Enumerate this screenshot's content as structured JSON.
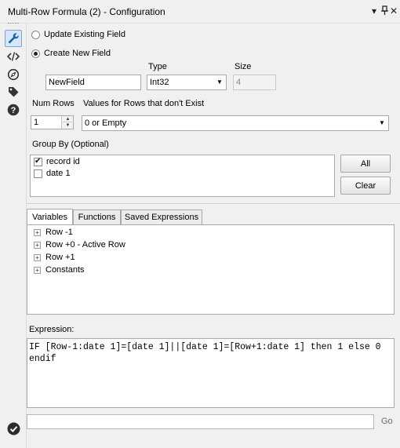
{
  "window": {
    "title": "Multi-Row Formula (2) - Configuration",
    "controls": {
      "dropdown": "▾",
      "pin": "ᵒ",
      "close": "✕"
    }
  },
  "toolbar": {
    "items": [
      {
        "name": "configuration",
        "icon": "wrench-icon"
      },
      {
        "name": "xml",
        "icon": "code-icon"
      },
      {
        "name": "annotation",
        "icon": "compass-icon"
      },
      {
        "name": "tag",
        "icon": "tag-icon"
      },
      {
        "name": "help",
        "icon": "help-icon"
      }
    ]
  },
  "options": {
    "update_existing_label": "Update Existing Field",
    "create_new_label": "Create New  Field",
    "selected": "create_new"
  },
  "new_field": {
    "name_value": "NewField",
    "type_label": "Type",
    "type_value": "Int32",
    "size_label": "Size",
    "size_value": "4"
  },
  "num_rows": {
    "label": "Num Rows",
    "value": "1"
  },
  "nonexistent_rows": {
    "label": "Values for Rows that don't Exist",
    "value": "0 or Empty"
  },
  "group_by": {
    "label": "Group By (Optional)",
    "items": [
      {
        "label": "record id",
        "checked": true
      },
      {
        "label": "date 1",
        "checked": false
      }
    ],
    "all_button": "All",
    "clear_button": "Clear"
  },
  "tabs": [
    {
      "label": "Variables",
      "active": true
    },
    {
      "label": "Functions",
      "active": false
    },
    {
      "label": "Saved Expressions",
      "active": false
    }
  ],
  "variables_tree": [
    {
      "label": "Row -1"
    },
    {
      "label": "Row +0 - Active Row"
    },
    {
      "label": "Row +1"
    },
    {
      "label": "Constants"
    }
  ],
  "expression": {
    "label": "Expression:",
    "text": "IF [Row-1:date 1]=[date 1]||[date 1]=[Row+1:date 1] then 1 else 0\nendif"
  },
  "footer": {
    "go_label": "Go",
    "status": "valid"
  },
  "colors": {
    "accent": "#1f5fa8",
    "background": "#f0f0f0",
    "status_ok": "#2b2b2b"
  }
}
